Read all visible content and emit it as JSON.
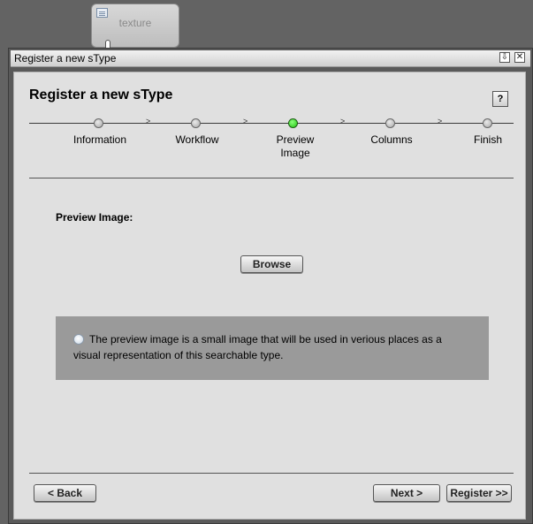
{
  "background_node": {
    "label": "texture"
  },
  "window": {
    "title": "Register a new sType",
    "controls": {
      "minimize": "⇩",
      "close": "✕"
    }
  },
  "wizard": {
    "title": "Register a new sType",
    "help_label": "?",
    "steps": [
      {
        "label": "Information",
        "active": false
      },
      {
        "label": "Workflow",
        "active": false
      },
      {
        "label": "Preview Image",
        "active": true
      },
      {
        "label": "Columns",
        "active": false
      },
      {
        "label": "Finish",
        "active": false
      }
    ],
    "step_separator": ">",
    "field_label": "Preview Image:",
    "browse_label": "Browse",
    "info_text": "The preview image is a small image that will be used in verious places as a visual representation of this searchable type.",
    "back_label": "< Back",
    "next_label": "Next >",
    "register_label": "Register >>"
  },
  "colors": {
    "active_step": "#21c40f",
    "panel_bg": "#e0e0e0",
    "info_bg": "#9a9a9a",
    "desktop_bg": "#636363"
  }
}
